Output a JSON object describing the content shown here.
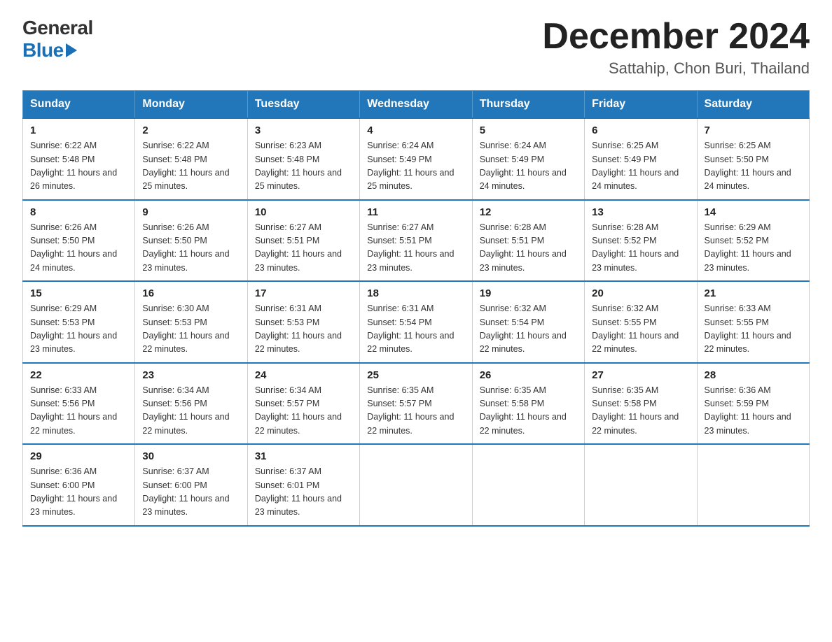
{
  "header": {
    "logo_general": "General",
    "logo_blue": "Blue",
    "month_title": "December 2024",
    "location": "Sattahip, Chon Buri, Thailand"
  },
  "weekdays": [
    "Sunday",
    "Monday",
    "Tuesday",
    "Wednesday",
    "Thursday",
    "Friday",
    "Saturday"
  ],
  "weeks": [
    [
      {
        "day": "1",
        "sunrise": "6:22 AM",
        "sunset": "5:48 PM",
        "daylight": "11 hours and 26 minutes."
      },
      {
        "day": "2",
        "sunrise": "6:22 AM",
        "sunset": "5:48 PM",
        "daylight": "11 hours and 25 minutes."
      },
      {
        "day": "3",
        "sunrise": "6:23 AM",
        "sunset": "5:48 PM",
        "daylight": "11 hours and 25 minutes."
      },
      {
        "day": "4",
        "sunrise": "6:24 AM",
        "sunset": "5:49 PM",
        "daylight": "11 hours and 25 minutes."
      },
      {
        "day": "5",
        "sunrise": "6:24 AM",
        "sunset": "5:49 PM",
        "daylight": "11 hours and 24 minutes."
      },
      {
        "day": "6",
        "sunrise": "6:25 AM",
        "sunset": "5:49 PM",
        "daylight": "11 hours and 24 minutes."
      },
      {
        "day": "7",
        "sunrise": "6:25 AM",
        "sunset": "5:50 PM",
        "daylight": "11 hours and 24 minutes."
      }
    ],
    [
      {
        "day": "8",
        "sunrise": "6:26 AM",
        "sunset": "5:50 PM",
        "daylight": "11 hours and 24 minutes."
      },
      {
        "day": "9",
        "sunrise": "6:26 AM",
        "sunset": "5:50 PM",
        "daylight": "11 hours and 23 minutes."
      },
      {
        "day": "10",
        "sunrise": "6:27 AM",
        "sunset": "5:51 PM",
        "daylight": "11 hours and 23 minutes."
      },
      {
        "day": "11",
        "sunrise": "6:27 AM",
        "sunset": "5:51 PM",
        "daylight": "11 hours and 23 minutes."
      },
      {
        "day": "12",
        "sunrise": "6:28 AM",
        "sunset": "5:51 PM",
        "daylight": "11 hours and 23 minutes."
      },
      {
        "day": "13",
        "sunrise": "6:28 AM",
        "sunset": "5:52 PM",
        "daylight": "11 hours and 23 minutes."
      },
      {
        "day": "14",
        "sunrise": "6:29 AM",
        "sunset": "5:52 PM",
        "daylight": "11 hours and 23 minutes."
      }
    ],
    [
      {
        "day": "15",
        "sunrise": "6:29 AM",
        "sunset": "5:53 PM",
        "daylight": "11 hours and 23 minutes."
      },
      {
        "day": "16",
        "sunrise": "6:30 AM",
        "sunset": "5:53 PM",
        "daylight": "11 hours and 22 minutes."
      },
      {
        "day": "17",
        "sunrise": "6:31 AM",
        "sunset": "5:53 PM",
        "daylight": "11 hours and 22 minutes."
      },
      {
        "day": "18",
        "sunrise": "6:31 AM",
        "sunset": "5:54 PM",
        "daylight": "11 hours and 22 minutes."
      },
      {
        "day": "19",
        "sunrise": "6:32 AM",
        "sunset": "5:54 PM",
        "daylight": "11 hours and 22 minutes."
      },
      {
        "day": "20",
        "sunrise": "6:32 AM",
        "sunset": "5:55 PM",
        "daylight": "11 hours and 22 minutes."
      },
      {
        "day": "21",
        "sunrise": "6:33 AM",
        "sunset": "5:55 PM",
        "daylight": "11 hours and 22 minutes."
      }
    ],
    [
      {
        "day": "22",
        "sunrise": "6:33 AM",
        "sunset": "5:56 PM",
        "daylight": "11 hours and 22 minutes."
      },
      {
        "day": "23",
        "sunrise": "6:34 AM",
        "sunset": "5:56 PM",
        "daylight": "11 hours and 22 minutes."
      },
      {
        "day": "24",
        "sunrise": "6:34 AM",
        "sunset": "5:57 PM",
        "daylight": "11 hours and 22 minutes."
      },
      {
        "day": "25",
        "sunrise": "6:35 AM",
        "sunset": "5:57 PM",
        "daylight": "11 hours and 22 minutes."
      },
      {
        "day": "26",
        "sunrise": "6:35 AM",
        "sunset": "5:58 PM",
        "daylight": "11 hours and 22 minutes."
      },
      {
        "day": "27",
        "sunrise": "6:35 AM",
        "sunset": "5:58 PM",
        "daylight": "11 hours and 22 minutes."
      },
      {
        "day": "28",
        "sunrise": "6:36 AM",
        "sunset": "5:59 PM",
        "daylight": "11 hours and 23 minutes."
      }
    ],
    [
      {
        "day": "29",
        "sunrise": "6:36 AM",
        "sunset": "6:00 PM",
        "daylight": "11 hours and 23 minutes."
      },
      {
        "day": "30",
        "sunrise": "6:37 AM",
        "sunset": "6:00 PM",
        "daylight": "11 hours and 23 minutes."
      },
      {
        "day": "31",
        "sunrise": "6:37 AM",
        "sunset": "6:01 PM",
        "daylight": "11 hours and 23 minutes."
      },
      null,
      null,
      null,
      null
    ]
  ]
}
